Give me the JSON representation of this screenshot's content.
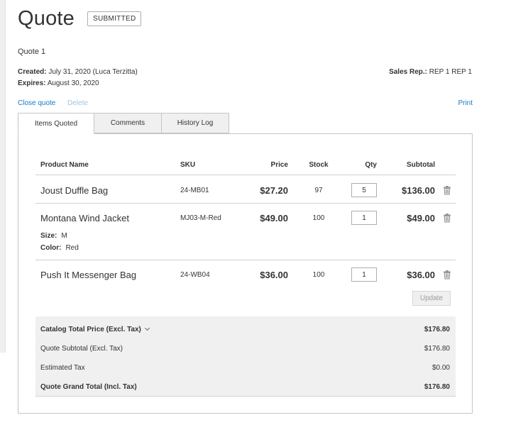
{
  "page": {
    "title": "Quote",
    "status": "SUBMITTED",
    "quote_name": "Quote 1"
  },
  "meta": {
    "created_label": "Created:",
    "created_value": "July 31, 2020 (Luca Terzitta)",
    "expires_label": "Expires:",
    "expires_value": "August 30, 2020",
    "rep_label": "Sales Rep.:",
    "rep_value": "REP 1 REP 1"
  },
  "actions": {
    "close": "Close quote",
    "delete": "Delete",
    "print": "Print"
  },
  "tabs": [
    {
      "label": "Items Quoted",
      "active": true
    },
    {
      "label": "Comments",
      "active": false
    },
    {
      "label": "History Log",
      "active": false
    }
  ],
  "table": {
    "headers": {
      "name": "Product Name",
      "sku": "SKU",
      "price": "Price",
      "stock": "Stock",
      "qty": "Qty",
      "subtotal": "Subtotal"
    },
    "rows": [
      {
        "name": "Joust Duffle Bag",
        "sku": "24-MB01",
        "price": "$27.20",
        "stock": "97",
        "qty": "5",
        "subtotal": "$136.00"
      },
      {
        "name": "Montana Wind Jacket",
        "sku": "MJ03-M-Red",
        "price": "$49.00",
        "stock": "100",
        "qty": "1",
        "subtotal": "$49.00",
        "options": [
          {
            "label": "Size:",
            "value": "M"
          },
          {
            "label": "Color:",
            "value": "Red"
          }
        ]
      },
      {
        "name": "Push It Messenger Bag",
        "sku": "24-WB04",
        "price": "$36.00",
        "stock": "100",
        "qty": "1",
        "subtotal": "$36.00"
      }
    ],
    "update_label": "Update"
  },
  "totals": {
    "catalog_label": "Catalog Total Price (Excl. Tax)",
    "catalog_value": "$176.80",
    "subtotal_label": "Quote Subtotal (Excl. Tax)",
    "subtotal_value": "$176.80",
    "tax_label": "Estimated Tax",
    "tax_value": "$0.00",
    "grand_label": "Quote Grand Total (Incl. Tax)",
    "grand_value": "$176.80"
  },
  "icons": {
    "trash": "trash-icon",
    "chevron": "chevron-down-icon"
  },
  "colors": {
    "link": "#1979c3",
    "link_disabled": "#9fc4e3",
    "totals_bg": "#f0f0f0"
  }
}
